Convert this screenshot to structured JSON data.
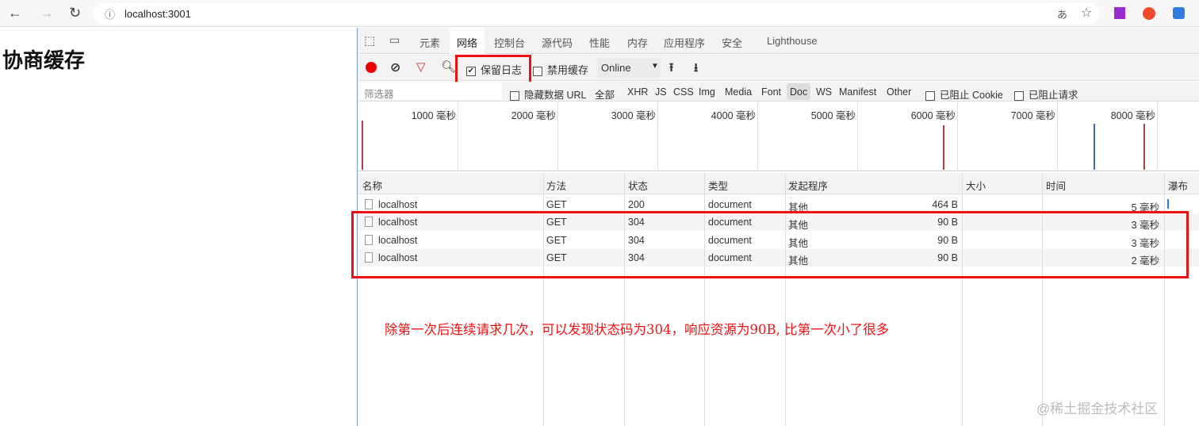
{
  "browser": {
    "url": "localhost:3001",
    "back_icon": "arrow-left",
    "forward_icon": "arrow-right",
    "reload_icon": "reload"
  },
  "page": {
    "heading": "协商缓存"
  },
  "devtools": {
    "tabs": [
      "元素",
      "网络",
      "控制台",
      "源代码",
      "性能",
      "内存",
      "应用程序",
      "安全",
      "Lighthouse"
    ],
    "active_tab": "网络",
    "toolbar": {
      "preserve_log": "保留日志",
      "preserve_log_checked": true,
      "disable_cache": "禁用缓存",
      "throttle": "Online"
    },
    "filter": {
      "placeholder": "筛选器",
      "hide_data_url": "隐藏数据 URL",
      "types": [
        "全部",
        "XHR",
        "JS",
        "CSS",
        "Img",
        "Media",
        "Font",
        "Doc",
        "WS",
        "Manifest",
        "Other"
      ],
      "active_type": "Doc",
      "blocked_cookies": "已阻止 Cookie",
      "blocked_requests": "已阻止请求"
    },
    "timeline_ticks": [
      "1000 毫秒",
      "2000 毫秒",
      "3000 毫秒",
      "4000 毫秒",
      "5000 毫秒",
      "6000 毫秒",
      "7000 毫秒",
      "8000 毫秒"
    ],
    "columns": [
      "名称",
      "方法",
      "状态",
      "类型",
      "发起程序",
      "大小",
      "时间",
      "瀑布"
    ],
    "rows": [
      {
        "name": "localhost",
        "method": "GET",
        "status": "200",
        "type": "document",
        "initiator": "其他",
        "size": "464 B",
        "time": "5 毫秒"
      },
      {
        "name": "localhost",
        "method": "GET",
        "status": "304",
        "type": "document",
        "initiator": "其他",
        "size": "90 B",
        "time": "3 毫秒"
      },
      {
        "name": "localhost",
        "method": "GET",
        "status": "304",
        "type": "document",
        "initiator": "其他",
        "size": "90 B",
        "time": "3 毫秒"
      },
      {
        "name": "localhost",
        "method": "GET",
        "status": "304",
        "type": "document",
        "initiator": "其他",
        "size": "90 B",
        "time": "2 毫秒"
      }
    ]
  },
  "annotation": "除第一次后连续请求几次，可以发现状态码为304，响应资源为90B, 比第一次小了很多",
  "watermark": "@稀土掘金技术社区"
}
